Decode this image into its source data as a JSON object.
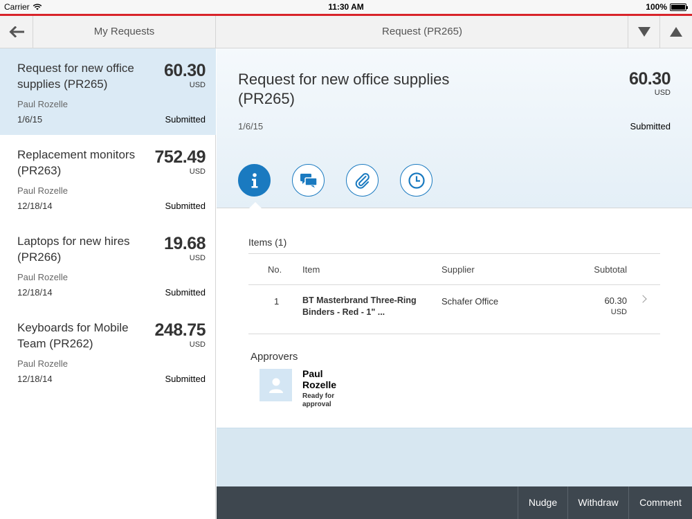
{
  "status_bar": {
    "carrier": "Carrier",
    "time": "11:30 AM",
    "battery": "100%"
  },
  "navbar": {
    "master_title": "My Requests",
    "detail_title": "Request (PR265)"
  },
  "requests": [
    {
      "title": "Request for new office supplies (PR265)",
      "amount": "60.30",
      "currency": "USD",
      "person": "Paul Rozelle",
      "date": "1/6/15",
      "status": "Submitted"
    },
    {
      "title": "Replacement monitors (PR263)",
      "amount": "752.49",
      "currency": "USD",
      "person": "Paul Rozelle",
      "date": "12/18/14",
      "status": "Submitted"
    },
    {
      "title": "Laptops for new hires (PR266)",
      "amount": "19.68",
      "currency": "USD",
      "person": "Paul Rozelle",
      "date": "12/18/14",
      "status": "Submitted"
    },
    {
      "title": "Keyboards for Mobile Team (PR262)",
      "amount": "248.75",
      "currency": "USD",
      "person": "Paul Rozelle",
      "date": "12/18/14",
      "status": "Submitted"
    }
  ],
  "detail": {
    "title": "Request for new office supplies (PR265)",
    "amount": "60.30",
    "currency": "USD",
    "date": "1/6/15",
    "status": "Submitted",
    "tabs": [
      {
        "icon": "info-icon",
        "active": true
      },
      {
        "icon": "comments-icon",
        "active": false
      },
      {
        "icon": "attachment-icon",
        "active": false
      },
      {
        "icon": "history-icon",
        "active": false
      }
    ],
    "items_heading": "Items (1)",
    "columns": {
      "no": "No.",
      "item": "Item",
      "supplier": "Supplier",
      "subtotal": "Subtotal"
    },
    "items": [
      {
        "no": "1",
        "item": "BT Masterbrand Three-Ring Binders - Red - 1\" ...",
        "supplier": "Schafer Office",
        "subtotal": "60.30",
        "currency": "USD"
      }
    ],
    "approvers_heading": "Approvers",
    "approvers": [
      {
        "name": "Paul Rozelle",
        "status": "Ready for approval"
      }
    ]
  },
  "footer": {
    "nudge": "Nudge",
    "withdraw": "Withdraw",
    "comment": "Comment"
  },
  "colors": {
    "accent": "#1a7ac0",
    "brand_red": "#d8232a",
    "footer_bg": "#3e474f",
    "selected_bg": "#dbeaf5"
  }
}
